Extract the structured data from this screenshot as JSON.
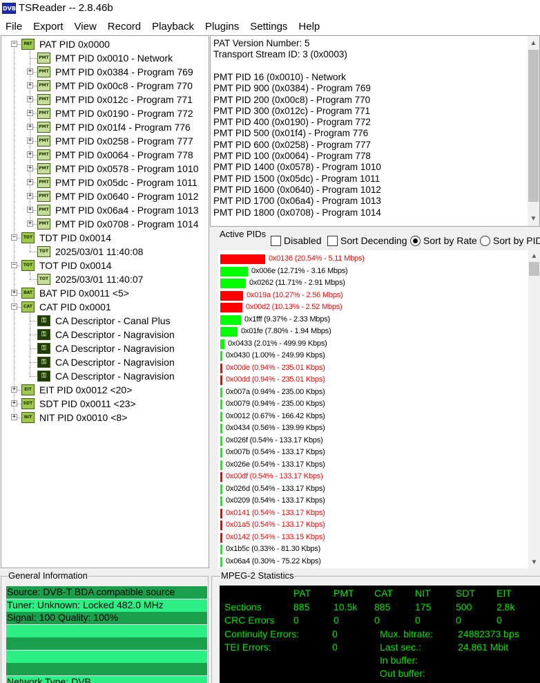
{
  "colors": {
    "accent_green": "#00ff00",
    "accent_red": "#ff0000",
    "red_text": "#ff0000",
    "stats_text": "#00e800",
    "stats_bg": "#000000",
    "gen_dark": "#1a9f4d",
    "gen_light": "#2cf085"
  },
  "window": {
    "title": "TSReader -- 2.8.46b",
    "icon": "DVB"
  },
  "menu": [
    "File",
    "Export",
    "View",
    "Record",
    "Playback",
    "Plugins",
    "Settings",
    "Help"
  ],
  "tree": [
    {
      "label": "PAT PID 0x0000",
      "icon": "PAT",
      "level": 0,
      "expand": "minus"
    },
    {
      "label": "PMT PID 0x0010 - Network",
      "icon": "PMT",
      "level": 1,
      "expand": "none"
    },
    {
      "label": "PMT PID 0x0384 - Program 769",
      "icon": "PMT",
      "level": 1,
      "expand": "plus"
    },
    {
      "label": "PMT PID 0x00c8 - Program 770",
      "icon": "PMT",
      "level": 1,
      "expand": "plus"
    },
    {
      "label": "PMT PID 0x012c - Program 771",
      "icon": "PMT",
      "level": 1,
      "expand": "plus"
    },
    {
      "label": "PMT PID 0x0190 - Program 772",
      "icon": "PMT",
      "level": 1,
      "expand": "plus"
    },
    {
      "label": "PMT PID 0x01f4 - Program 776",
      "icon": "PMT",
      "level": 1,
      "expand": "plus"
    },
    {
      "label": "PMT PID 0x0258 - Program 777",
      "icon": "PMT",
      "level": 1,
      "expand": "plus"
    },
    {
      "label": "PMT PID 0x0064 - Program 778",
      "icon": "PMT",
      "level": 1,
      "expand": "plus"
    },
    {
      "label": "PMT PID 0x0578 - Program 1010",
      "icon": "PMT",
      "level": 1,
      "expand": "plus"
    },
    {
      "label": "PMT PID 0x05dc - Program 1011",
      "icon": "PMT",
      "level": 1,
      "expand": "plus"
    },
    {
      "label": "PMT PID 0x0640 - Program 1012",
      "icon": "PMT",
      "level": 1,
      "expand": "plus"
    },
    {
      "label": "PMT PID 0x06a4 - Program 1013",
      "icon": "PMT",
      "level": 1,
      "expand": "plus"
    },
    {
      "label": "PMT PID 0x0708 - Program 1014",
      "icon": "PMT",
      "level": 1,
      "expand": "plus"
    },
    {
      "label": "TDT PID 0x0014",
      "icon": "TDT",
      "level": 0,
      "expand": "minus"
    },
    {
      "label": "2025/03/01 11:40:08",
      "icon": "TDT",
      "level": 1,
      "expand": "none"
    },
    {
      "label": "TOT PID 0x0014",
      "icon": "TOT",
      "level": 0,
      "expand": "minus"
    },
    {
      "label": "2025/03/01 11:40:07",
      "icon": "TOT",
      "level": 1,
      "expand": "none"
    },
    {
      "label": "BAT PID 0x0011 <5>",
      "icon": "BAT",
      "level": 0,
      "expand": "plus"
    },
    {
      "label": "CAT PID 0x0001",
      "icon": "CAT",
      "level": 0,
      "expand": "minus"
    },
    {
      "label": "CA Descriptor - Canal Plus",
      "icon": "CA",
      "level": 1,
      "expand": "none"
    },
    {
      "label": "CA Descriptor - Nagravision",
      "icon": "CA",
      "level": 1,
      "expand": "none"
    },
    {
      "label": "CA Descriptor - Nagravision",
      "icon": "CA",
      "level": 1,
      "expand": "none"
    },
    {
      "label": "CA Descriptor - Nagravision",
      "icon": "CA",
      "level": 1,
      "expand": "none"
    },
    {
      "label": "CA Descriptor - Nagravision",
      "icon": "CA",
      "level": 1,
      "expand": "none"
    },
    {
      "label": "EIT PID 0x0012 <20>",
      "icon": "EIT",
      "level": 0,
      "expand": "plus"
    },
    {
      "label": "SDT PID 0x0011 <23>",
      "icon": "SDT",
      "level": 0,
      "expand": "plus"
    },
    {
      "label": "NIT PID 0x0010 <8>",
      "icon": "NIT",
      "level": 0,
      "expand": "plus"
    }
  ],
  "pat_info": [
    "PAT Version Number: 5",
    "Transport Stream ID: 3 (0x0003)",
    "",
    "PMT PID 16 (0x0010) - Network",
    "PMT PID 900 (0x0384) - Program 769",
    "PMT PID 200 (0x00c8) - Program 770",
    "PMT PID 300 (0x012c) - Program 771",
    "PMT PID 400 (0x0190) - Program 772",
    "PMT PID 500 (0x01f4) - Program 776",
    "PMT PID 600 (0x0258) - Program 777",
    "PMT PID 100 (0x0064) - Program 778",
    "PMT PID 1400 (0x0578) - Program 1010",
    "PMT PID 1500 (0x05dc) - Program 1011",
    "PMT PID 1600 (0x0640) - Program 1012",
    "PMT PID 1700 (0x06a4) - Program 1013",
    "PMT PID 1800 (0x0708) - Program 1014"
  ],
  "active_pids": {
    "label": "Active PIDs",
    "options": [
      {
        "label": "Disabled",
        "type": "checkbox",
        "checked": false
      },
      {
        "label": "Sort Decending",
        "type": "checkbox",
        "checked": false
      },
      {
        "label": "Sort by Rate",
        "type": "radio",
        "checked": true
      },
      {
        "label": "Sort by PID",
        "type": "radio",
        "checked": false
      }
    ],
    "rows": [
      {
        "text": "0x0136 (20.54% - 5.11 Mbps)",
        "pct": 20.54,
        "scrambled": true
      },
      {
        "text": "0x006e (12.71% - 3.16 Mbps)",
        "pct": 12.71,
        "scrambled": false
      },
      {
        "text": "0x0262 (11.71% - 2.91 Mbps)",
        "pct": 11.71,
        "scrambled": false
      },
      {
        "text": "0x019a (10.27% - 2.56 Mbps)",
        "pct": 10.27,
        "scrambled": true
      },
      {
        "text": "0x00d2 (10.13% - 2.52 Mbps)",
        "pct": 10.13,
        "scrambled": true
      },
      {
        "text": "0x1fff (9.37% - 2.33 Mbps)",
        "pct": 9.37,
        "scrambled": false
      },
      {
        "text": "0x01fe (7.80% - 1.94 Mbps)",
        "pct": 7.8,
        "scrambled": false
      },
      {
        "text": "0x0433 (2.01% - 499.99 Kbps)",
        "pct": 2.01,
        "scrambled": false
      },
      {
        "text": "0x0430 (1.00% - 249.99 Kbps)",
        "pct": 1.0,
        "scrambled": false
      },
      {
        "text": "0x00de (0.94% - 235.01 Kbps)",
        "pct": 0.94,
        "scrambled": true
      },
      {
        "text": "0x00dd (0.94% - 235.01 Kbps)",
        "pct": 0.94,
        "scrambled": true
      },
      {
        "text": "0x007a (0.94% - 235.00 Kbps)",
        "pct": 0.94,
        "scrambled": false
      },
      {
        "text": "0x0079 (0.94% - 235.00 Kbps)",
        "pct": 0.94,
        "scrambled": false
      },
      {
        "text": "0x0012 (0.67% - 166.42 Kbps)",
        "pct": 0.67,
        "scrambled": false
      },
      {
        "text": "0x0434 (0.56% - 139.99 Kbps)",
        "pct": 0.56,
        "scrambled": false
      },
      {
        "text": "0x026f (0.54% - 133.17 Kbps)",
        "pct": 0.54,
        "scrambled": false
      },
      {
        "text": "0x007b (0.54% - 133.17 Kbps)",
        "pct": 0.54,
        "scrambled": false
      },
      {
        "text": "0x026e (0.54% - 133.17 Kbps)",
        "pct": 0.54,
        "scrambled": false
      },
      {
        "text": "0x00df (0.54% - 133.17 Kbps)",
        "pct": 0.54,
        "scrambled": true
      },
      {
        "text": "0x026d (0.54% - 133.17 Kbps)",
        "pct": 0.54,
        "scrambled": false
      },
      {
        "text": "0x0209 (0.54% - 133.17 Kbps)",
        "pct": 0.54,
        "scrambled": false
      },
      {
        "text": "0x0141 (0.54% - 133.17 Kbps)",
        "pct": 0.54,
        "scrambled": true
      },
      {
        "text": "0x01a5 (0.54% - 133.17 Kbps)",
        "pct": 0.54,
        "scrambled": true
      },
      {
        "text": "0x0142 (0.54% - 133.15 Kbps)",
        "pct": 0.54,
        "scrambled": true
      },
      {
        "text": "0x1b5c (0.33% - 81.30 Kbps)",
        "pct": 0.33,
        "scrambled": false
      },
      {
        "text": "0x06a4 (0.30% - 75.22 Kbps)",
        "pct": 0.3,
        "scrambled": false
      }
    ]
  },
  "general_info": {
    "label": "General Information",
    "rows": [
      "Source: DVB-T BDA compatible source",
      "Tuner: Unknown: Locked 482.0 MHz",
      "Signal: 100 Quality: 100%",
      "",
      "",
      "",
      "",
      "Network Type: DVB"
    ]
  },
  "mpeg_stats": {
    "label": "MPEG-2 Statistics",
    "columns": [
      "PAT",
      "PMT",
      "CAT",
      "NIT",
      "SDT",
      "EIT"
    ],
    "rows": [
      {
        "label": "Sections",
        "values": [
          "885",
          "10.5k",
          "885",
          "175",
          "500",
          "2.8k"
        ]
      },
      {
        "label": "CRC Errors",
        "values": [
          "0",
          "0",
          "0",
          "0",
          "0",
          "0"
        ]
      }
    ],
    "continuity_label": "Continuity Errors:",
    "continuity_value": "0",
    "tei_label": "TEI Errors:",
    "tei_value": "0",
    "mux_label": "Mux. bitrate:",
    "mux_value": "24882373 bps",
    "last_label": "Last sec.:",
    "last_value": "24.861 Mbit",
    "in_buffer_label": "In buffer:",
    "out_buffer_label": "Out buffer:"
  }
}
